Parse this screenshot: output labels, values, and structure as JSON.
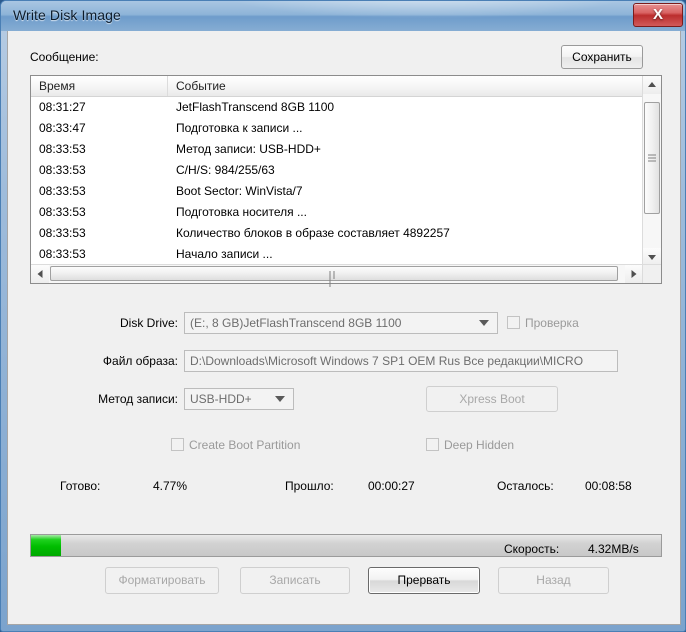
{
  "window": {
    "title": "Write Disk Image",
    "close_label": "X"
  },
  "message_panel": {
    "label": "Сообщение:",
    "save_label": "Сохранить"
  },
  "log": {
    "columns": [
      "Время",
      "Событие"
    ],
    "rows": [
      {
        "time": "08:31:27",
        "event": "JetFlashTranscend 8GB  1100"
      },
      {
        "time": "08:33:47",
        "event": "Подготовка к записи ..."
      },
      {
        "time": "08:33:53",
        "event": "Метод записи: USB-HDD+"
      },
      {
        "time": "08:33:53",
        "event": "C/H/S: 984/255/63"
      },
      {
        "time": "08:33:53",
        "event": "Boot Sector: WinVista/7"
      },
      {
        "time": "08:33:53",
        "event": "Подготовка носителя ..."
      },
      {
        "time": "08:33:53",
        "event": "Количество блоков в образе составляет 4892257"
      },
      {
        "time": "08:33:53",
        "event": "Начало записи ..."
      }
    ]
  },
  "form": {
    "disk_drive_label": "Disk Drive:",
    "disk_drive_value": "(E:, 8 GB)JetFlashTranscend 8GB  1100",
    "verify_label": "Проверка",
    "image_file_label": "Файл образа:",
    "image_file_value": "D:\\Downloads\\Microsoft Windows 7 SP1 OEM Rus Все редакции\\MICRO",
    "write_method_label": "Метод записи:",
    "write_method_value": "USB-HDD+",
    "xpress_boot_label": "Xpress Boot",
    "create_boot_partition_label": "Create Boot Partition",
    "deep_hidden_label": "Deep Hidden"
  },
  "status": {
    "done_label": "Готово:",
    "done_value": "4.77%",
    "elapsed_label": "Прошло:",
    "elapsed_value": "00:00:27",
    "remaining_label": "Осталось:",
    "remaining_value": "00:08:58",
    "speed_label": "Скорость:",
    "speed_value": "4.32MB/s",
    "progress_percent": 4.77,
    "progress_color": "#00bd00"
  },
  "buttons": {
    "format_label": "Форматировать",
    "write_label": "Записать",
    "abort_label": "Прервать",
    "back_label": "Назад"
  }
}
